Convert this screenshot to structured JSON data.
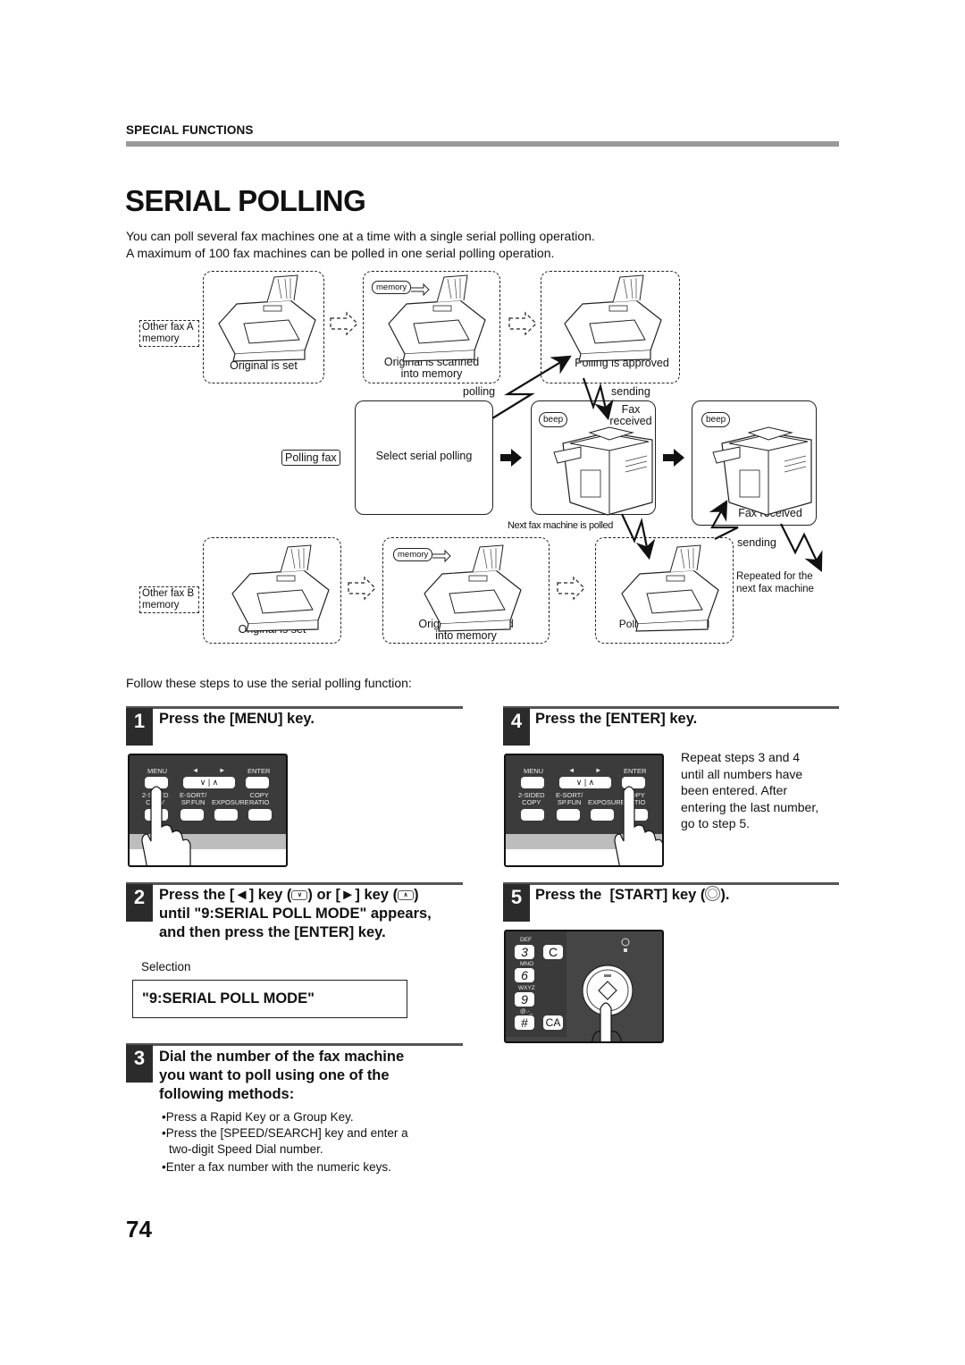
{
  "header": {
    "section_label": "SPECIAL FUNCTIONS",
    "title": "SERIAL POLLING",
    "intro": [
      "You can poll several fax machines one at a time with a single serial polling operation.",
      "A maximum of 100 fax machines can be polled in one serial polling operation."
    ]
  },
  "diagram": {
    "other_fax_a": [
      "Other fax A",
      "memory"
    ],
    "other_fax_b": [
      "Other fax B",
      "memory"
    ],
    "memory_pill": "memory",
    "original_set": "Original is set",
    "original_scanned": [
      "Original is scanned",
      "into memory"
    ],
    "polling_approved": "Polling is approved",
    "polling": "polling",
    "sending": "sending",
    "fax_received_top": [
      "Fax",
      "received"
    ],
    "beep": "beep",
    "polling_fax": "Polling fax",
    "select_serial_polling": "Select serial polling",
    "next_fax_polled": "Next fax machine is polled",
    "fax_received": "Fax received",
    "repeated": [
      "Repeated for the",
      "next fax machine"
    ]
  },
  "follow_text": "Follow these steps to use the serial polling function:",
  "steps": [
    {
      "num": "1",
      "title": "Press the [MENU] key."
    },
    {
      "num": "2",
      "title_lines": [
        "Press the [◄] key (",
        ") or [►] key (",
        ")",
        "until \"9:SERIAL POLL MODE\" appears,",
        "and then press the [ENTER] key."
      ],
      "selection_label": "Selection",
      "display": "\"9:SERIAL POLL MODE\""
    },
    {
      "num": "3",
      "title_lines": [
        "Dial the number of the fax machine",
        "you want to poll using one of the",
        "following methods:"
      ],
      "bullets": [
        "Press a Rapid Key or a Group Key.",
        "Press the [SPEED/SEARCH] key and enter a",
        "two-digit Speed Dial number.",
        "Enter a fax number with the numeric keys."
      ]
    },
    {
      "num": "4",
      "title": "Press the [ENTER] key.",
      "note": [
        "Repeat steps 3 and 4",
        "until all numbers have",
        "been entered. After",
        "entering the last number,",
        "go to step 5."
      ]
    },
    {
      "num": "5",
      "title_pre": "Press the  [START] key (",
      "title_post": ")."
    }
  ],
  "control_panel": {
    "menu": "MENU",
    "left": "◄",
    "right": "►",
    "enter": "ENTER",
    "down": "∨",
    "up": "∧",
    "two_sided": [
      "2-SIDED",
      "COPY"
    ],
    "esort": [
      "E-SORT/",
      "SP.FUN"
    ],
    "exposure": "EXPOSURE",
    "copy_ratio": [
      "COPY",
      "RATIO"
    ]
  },
  "keypad": {
    "def": "DEF",
    "mno": "MNO",
    "wxyz": "WXYZ",
    "sym": "@.-_",
    "k3": "3",
    "k6": "6",
    "k9": "9",
    "hash": "#",
    "c": "C",
    "ca": "CA"
  },
  "page_number": "74"
}
